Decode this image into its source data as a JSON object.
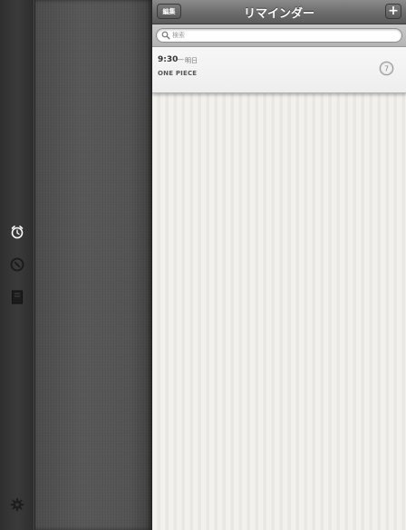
{
  "navbar": {
    "title": "リマインダー",
    "edit_label": "編集",
    "add_label": "+"
  },
  "search": {
    "placeholder": "検索"
  },
  "reminders": [
    {
      "time": "9:30",
      "separator": "—",
      "day": "明日",
      "title": "ONE PIECE",
      "check_number": "7"
    }
  ],
  "sidebar": {
    "icons": [
      "alarm-clock-icon",
      "compass-icon",
      "book-icon",
      "gear-icon"
    ]
  },
  "colors": {
    "navbar": "#6e6e6e",
    "panel_background": "#f2f1ee",
    "sidebar": "#333333",
    "middle_panel": "#525252"
  }
}
